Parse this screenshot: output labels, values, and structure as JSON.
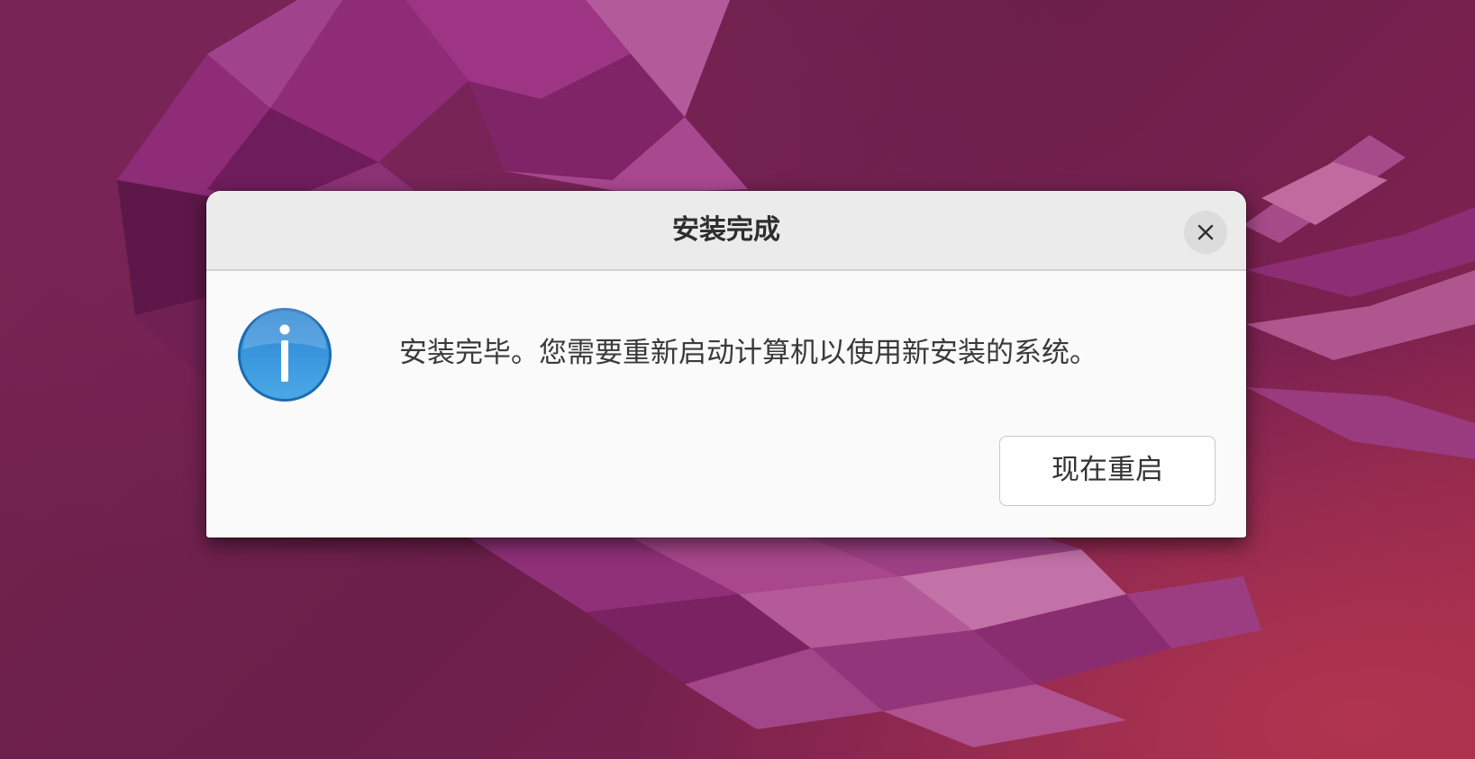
{
  "dialog": {
    "title": "安装完成",
    "message": "安装完毕。您需要重新启动计算机以使用新安装的系统。",
    "restart_button_label": "现在重启",
    "close_icon": "close-icon",
    "info_icon": "info-icon"
  },
  "colors": {
    "wallpaper": "#6e2249",
    "dialog_bg": "#fafafa",
    "titlebar_bg": "#ebebeb",
    "info_icon_blue": "#2f8fd8"
  }
}
